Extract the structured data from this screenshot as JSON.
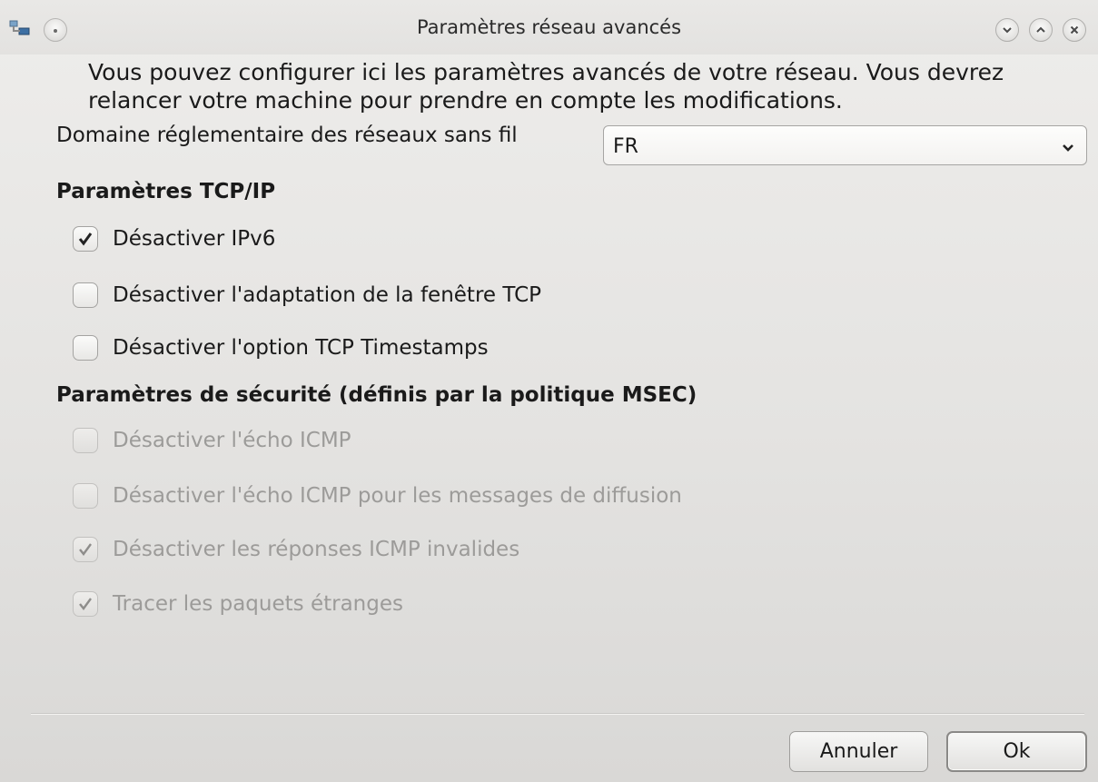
{
  "window": {
    "title": "Paramètres réseau avancés",
    "icons": {
      "app": "network-app-icon",
      "menu": "window-menu-icon",
      "minimize": "chevron-down-icon",
      "maximize": "chevron-up-icon",
      "close": "close-icon"
    }
  },
  "description": "Vous pouvez configurer ici les paramètres avancés de votre réseau. Vous devrez relancer votre machine pour prendre en compte les modifications.",
  "domain": {
    "label": "Domaine réglementaire des réseaux sans fil",
    "selected": "FR"
  },
  "tcp_section": {
    "title": "Paramètres TCP/IP",
    "options": [
      {
        "label": "Désactiver IPv6",
        "checked": true,
        "enabled": true
      },
      {
        "label": "Désactiver l'adaptation de la fenêtre TCP",
        "checked": false,
        "enabled": true
      },
      {
        "label": "Désactiver l'option TCP Timestamps",
        "checked": false,
        "enabled": true
      }
    ]
  },
  "security_section": {
    "title": "Paramètres de sécurité (définis par la politique MSEC)",
    "options": [
      {
        "label": "Désactiver l'écho ICMP",
        "checked": false,
        "enabled": false
      },
      {
        "label": "Désactiver l'écho ICMP pour les messages de diffusion",
        "checked": false,
        "enabled": false
      },
      {
        "label": "Désactiver les réponses ICMP invalides",
        "checked": true,
        "enabled": false
      },
      {
        "label": "Tracer les paquets étranges",
        "checked": true,
        "enabled": false
      }
    ]
  },
  "buttons": {
    "cancel": "Annuler",
    "ok": "Ok"
  },
  "colors": {
    "window_bg": "#e6e5e3",
    "text": "#1a1a1a",
    "disabled_text": "#9c9b99",
    "border": "#a4a3a1"
  }
}
